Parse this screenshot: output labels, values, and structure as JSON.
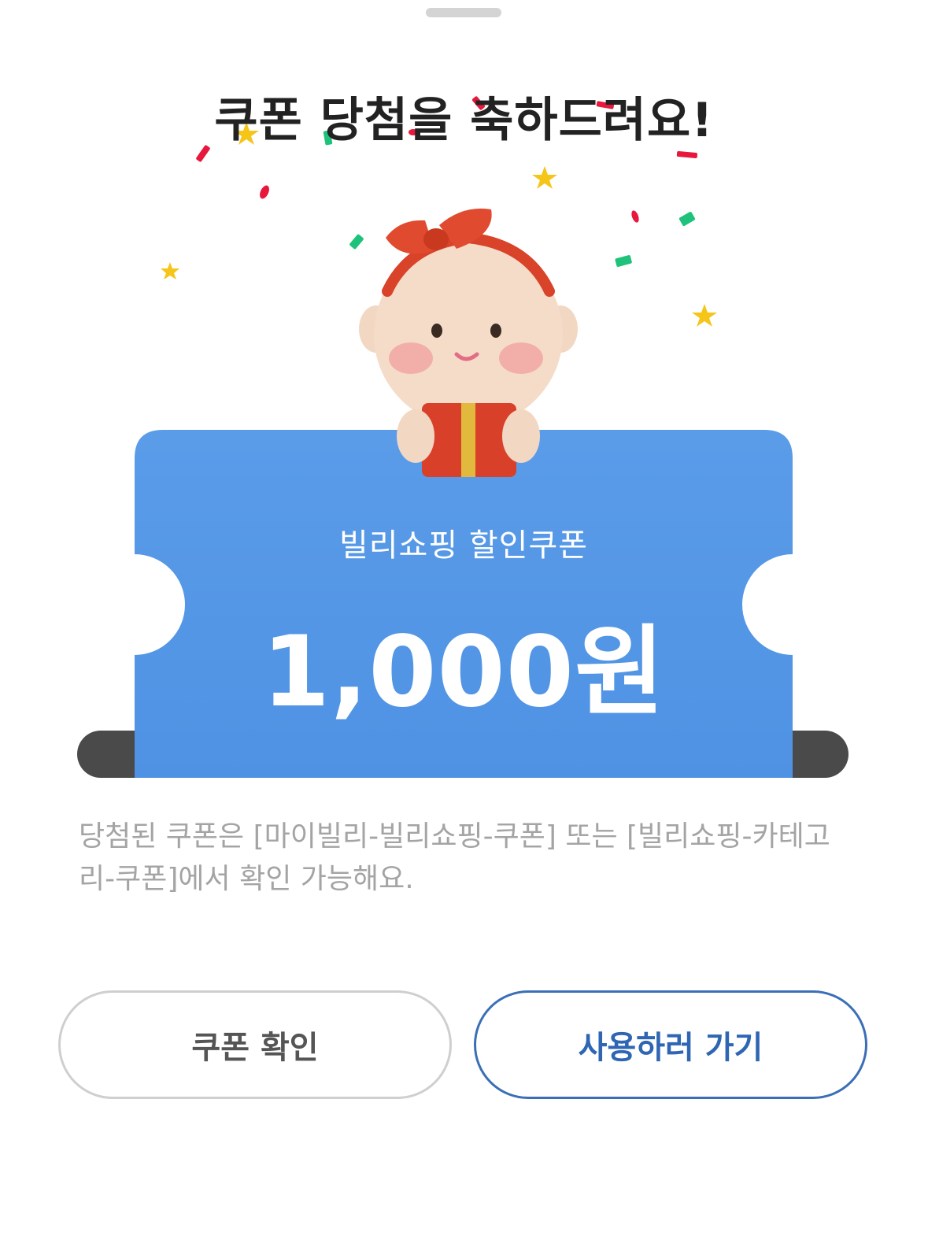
{
  "sheet": {
    "title": "쿠폰 당첨을 축하드려요!"
  },
  "coupon": {
    "name": "빌리쇼핑 할인쿠폰",
    "amount": "1,000원",
    "color": "#4f94e4"
  },
  "notice": {
    "text": "당첨된 쿠폰은 [마이빌리-빌리쇼핑-쿠폰] 또는 [빌리쇼핑-카테고리-쿠폰]에서 확인 가능해요."
  },
  "buttons": {
    "check_label": "쿠폰 확인",
    "use_label": "사용하러 가기"
  },
  "colors": {
    "accent": "#2f66b3",
    "confetti_red": "#e8173c",
    "confetti_green": "#1fc27a",
    "confetti_star": "#f5c518"
  },
  "icons": {
    "character": "baby-with-gift-icon",
    "confetti": "confetti-stars-icon"
  }
}
